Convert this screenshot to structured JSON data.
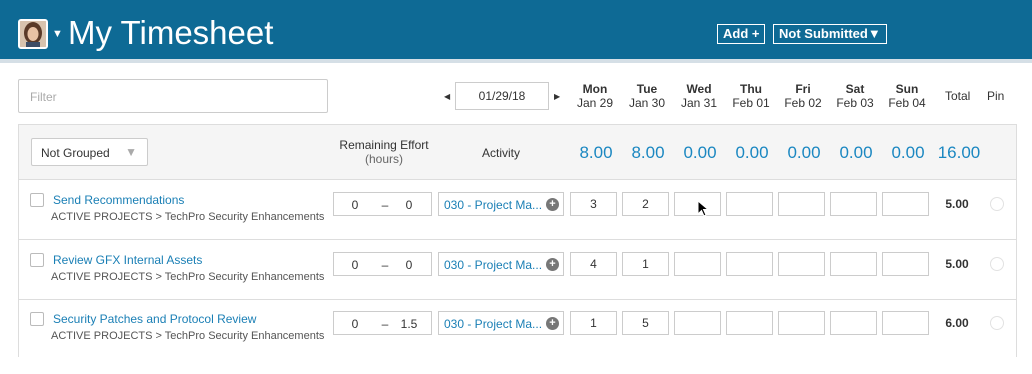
{
  "header": {
    "title": "My Timesheet",
    "add_label": "Add +",
    "status_label": "Not Submitted▼",
    "bg_color": "#0e6a95"
  },
  "filter": {
    "placeholder": "Filter"
  },
  "week": {
    "date": "01/29/18",
    "prev": "◀",
    "next": "▶",
    "days": [
      {
        "name": "Mon",
        "date": "Jan 29"
      },
      {
        "name": "Tue",
        "date": "Jan 30"
      },
      {
        "name": "Wed",
        "date": "Jan 31"
      },
      {
        "name": "Thu",
        "date": "Feb 01"
      },
      {
        "name": "Fri",
        "date": "Feb 02"
      },
      {
        "name": "Sat",
        "date": "Feb 03"
      },
      {
        "name": "Sun",
        "date": "Feb 04"
      }
    ],
    "total_label": "Total",
    "pin_label": "Pin"
  },
  "group": {
    "select_value": "Not Grouped",
    "remaining_label": "Remaining Effort",
    "remaining_sub": "(hours)",
    "activity_label": "Activity",
    "day_totals": [
      "8.00",
      "8.00",
      "0.00",
      "0.00",
      "0.00",
      "0.00",
      "0.00"
    ],
    "grand_total": "16.00",
    "accent_color": "#1a87c1"
  },
  "rows": [
    {
      "name": "Send Recommendations",
      "path": "ACTIVE PROJECTS > TechPro Security Enhancements",
      "effort_a": "0",
      "effort_dash": "–",
      "effort_b": "0",
      "activity": "030 - Project Ma...",
      "hours": [
        "3",
        "2",
        "",
        "",
        "",
        "",
        ""
      ],
      "total": "5.00"
    },
    {
      "name": "Review GFX Internal Assets",
      "path": "ACTIVE PROJECTS > TechPro Security Enhancements",
      "effort_a": "0",
      "effort_dash": "–",
      "effort_b": "0",
      "activity": "030 - Project Ma...",
      "hours": [
        "4",
        "1",
        "",
        "",
        "",
        "",
        ""
      ],
      "total": "5.00"
    },
    {
      "name": "Security Patches and Protocol Review",
      "path": "ACTIVE PROJECTS > TechPro Security Enhancements",
      "effort_a": "0",
      "effort_dash": "–",
      "effort_b": "1.5",
      "activity": "030 - Project Ma...",
      "hours": [
        "1",
        "5",
        "",
        "",
        "",
        "",
        ""
      ],
      "total": "6.00"
    }
  ]
}
